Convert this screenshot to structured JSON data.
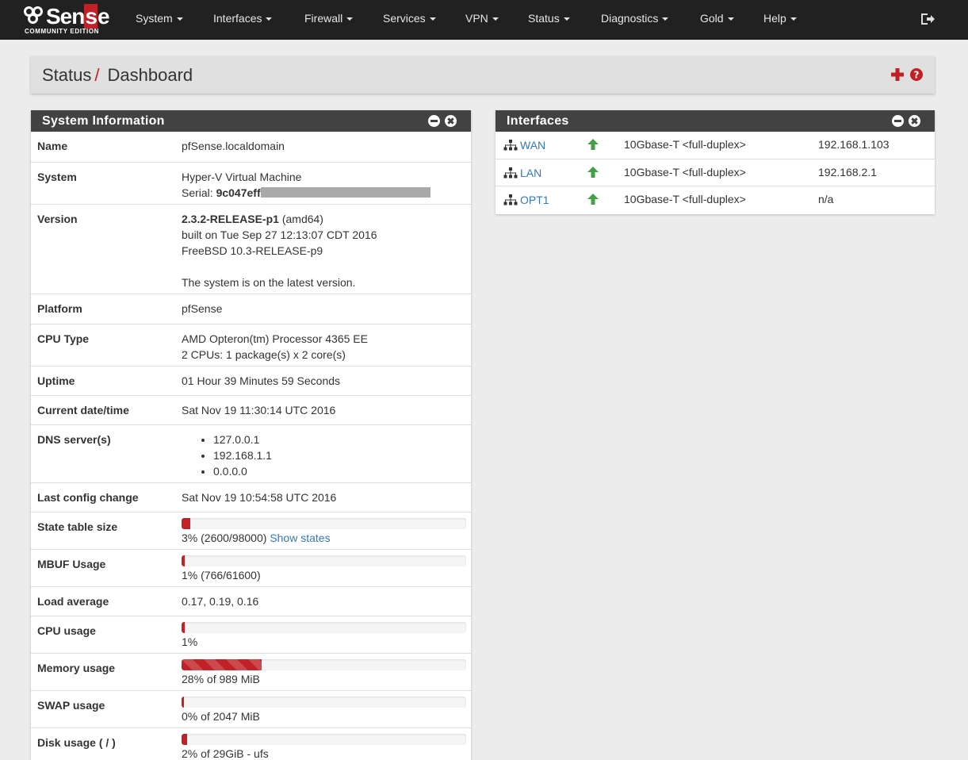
{
  "brand": {
    "name_pre": "Sen",
    "name_hl": "s",
    "name_post": "e",
    "edition": "COMMUNITY EDITION"
  },
  "nav": [
    "System",
    "Interfaces",
    "Firewall",
    "Services",
    "VPN",
    "Status",
    "Diagnostics",
    "Gold",
    "Help"
  ],
  "breadcrumb": {
    "section": "Status",
    "page": "Dashboard"
  },
  "system_info": {
    "title": "System Information",
    "name_label": "Name",
    "name_value": "pfSense.localdomain",
    "system_label": "System",
    "system_value": "Hyper-V Virtual Machine",
    "serial_label": "Serial:",
    "serial_value": "9c047eff",
    "version_label": "Version",
    "version_bold": "2.3.2-RELEASE-p1",
    "version_arch": " (amd64)",
    "version_built": "built on Tue Sep 27 12:13:07 CDT 2016",
    "version_freebsd": "FreeBSD 10.3-RELEASE-p9",
    "version_status": "The system is on the latest version.",
    "platform_label": "Platform",
    "platform_value": "pfSense",
    "cpu_label": "CPU Type",
    "cpu_value": "AMD Opteron(tm) Processor 4365 EE",
    "cpu_count": "2 CPUs: 1 package(s) x 2 core(s)",
    "uptime_label": "Uptime",
    "uptime_value": "01 Hour 39 Minutes 59 Seconds",
    "datetime_label": "Current date/time",
    "datetime_value": "Sat Nov 19 11:30:14 UTC 2016",
    "dns_label": "DNS server(s)",
    "dns": [
      "127.0.0.1",
      "192.168.1.1",
      "0.0.0.0"
    ],
    "lastconfig_label": "Last config change",
    "lastconfig_value": "Sat Nov 19 10:54:58 UTC 2016",
    "state_label": "State table size",
    "state_text": "3% (2600/98000) ",
    "state_link": "Show states",
    "state_pct": 3,
    "mbuf_label": "MBUF Usage",
    "mbuf_text": "1% (766/61600)",
    "mbuf_pct": 1,
    "load_label": "Load average",
    "load_value": "0.17, 0.19, 0.16",
    "cpuuse_label": "CPU usage",
    "cpuuse_text": "1%",
    "cpuuse_pct": 1,
    "mem_label": "Memory usage",
    "mem_text": "28% of 989 MiB",
    "mem_pct": 28,
    "swap_label": "SWAP usage",
    "swap_text": "0% of 2047 MiB",
    "swap_pct": 0,
    "disk_label": "Disk usage ( / )",
    "disk_text": "2% of 29GiB - ufs",
    "disk_pct": 2
  },
  "interfaces": {
    "title": "Interfaces",
    "rows": [
      {
        "name": "WAN",
        "media": "10Gbase-T <full-duplex>",
        "ip": "192.168.1.103"
      },
      {
        "name": "LAN",
        "media": "10Gbase-T <full-duplex>",
        "ip": "192.168.2.1"
      },
      {
        "name": "OPT1",
        "media": "10Gbase-T <full-duplex>",
        "ip": "n/a"
      }
    ]
  },
  "colors": {
    "accent": "#c02126",
    "navbar": "#212121",
    "panel_heading": "#424242",
    "status_up": "#43a047",
    "link": "#337ab7"
  }
}
